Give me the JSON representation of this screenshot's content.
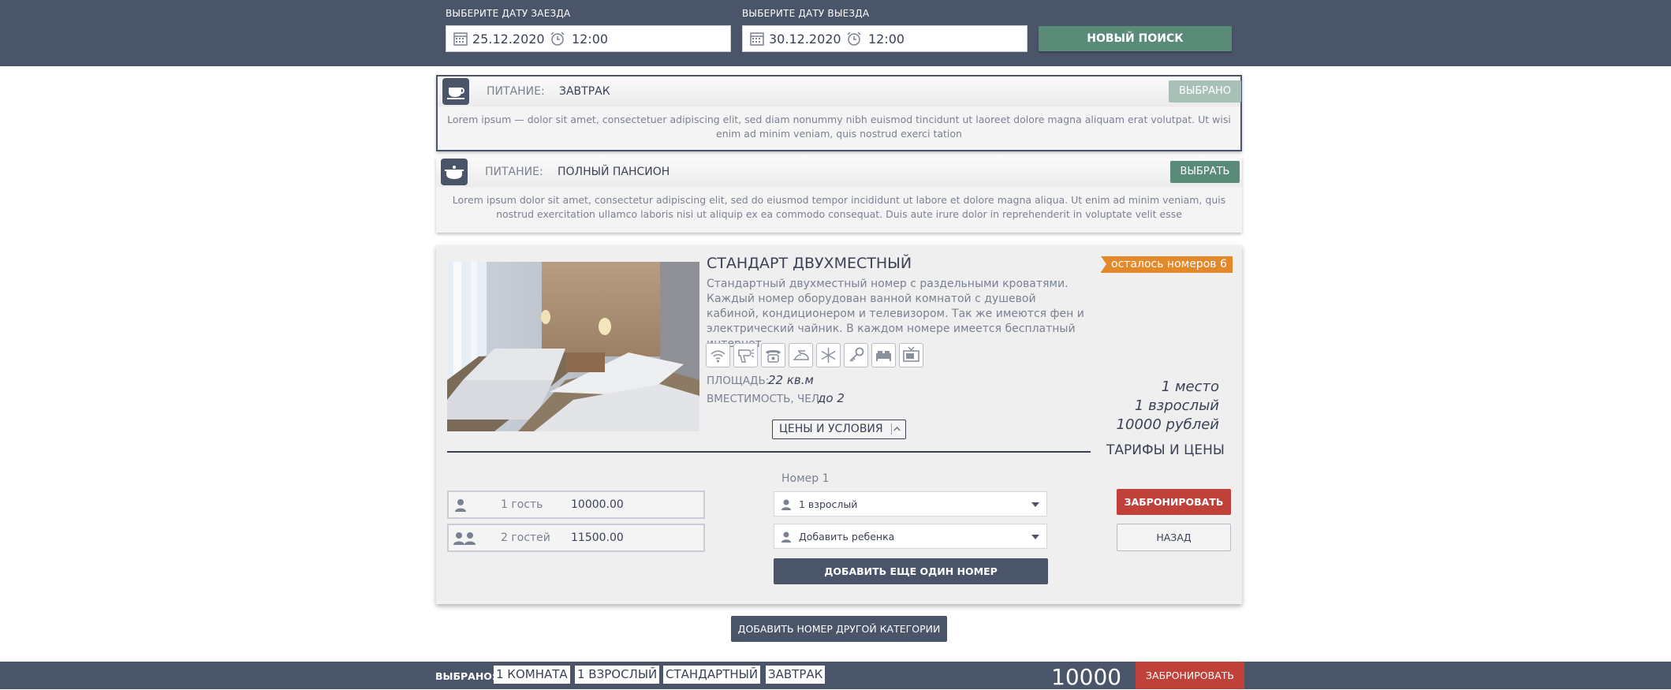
{
  "search": {
    "checkin_label": "ВЫБЕРИТЕ ДАТУ ЗАЕЗДА",
    "checkin_date": "25.12.2020",
    "checkin_time": "12:00",
    "checkout_label": "ВЫБЕРИТЕ ДАТУ ВЫЕЗДА",
    "checkout_date": "30.12.2020",
    "checkout_time": "12:00",
    "new_search_label": "НОВЫЙ ПОИСК"
  },
  "meals": [
    {
      "key": "ПИТАНИЕ:",
      "value": "ЗАВТРАК",
      "button": "ВЫБРАНО",
      "selected": true,
      "description": "Lorem ipsum — dolor sit amet, consectetuer adipiscing elit, sed diam nonummy nibh euismod tincidunt ut laoreet dolore magna aliquam erat volutpat. Ut wisi enim ad minim veniam, quis nostrud exerci tation",
      "icon": "cup-icon"
    },
    {
      "key": "ПИТАНИЕ:",
      "value": "ПОЛНЫЙ ПАНСИОН",
      "button": "ВЫБРАТЬ",
      "selected": false,
      "description": "Lorem ipsum dolor sit amet, consectetur adipiscing elit, sed do eiusmod tempor incididunt ut labore et dolore magna aliqua. Ut enim ad minim veniam, quis nostrud exercitation ullamco laboris nisi ut aliquip ex ea commodo consequat. Duis aute irure dolor in reprehenderit in voluptate velit esse",
      "icon": "pot-icon"
    }
  ],
  "room": {
    "title": "СТАНДАРТ ДВУХМЕСТНЫЙ",
    "description": "Стандартный двухместный номер с раздельными кроватями. Каждый номер оборудован ванной комнатой с душевой кабиной, кондиционером и телевизором. Так же имеются фен и электрический чайник. В каждом номере имеется бесплатный интернет.",
    "badge": "осталось номеров 6",
    "amenities": [
      "wifi-icon",
      "hairdryer-icon",
      "phone-icon",
      "iron-icon",
      "snowflake-icon",
      "key-icon",
      "bed-icon",
      "tv-icon"
    ],
    "area_label": "ПЛОЩАДЬ:",
    "area_value": "22 кв.м",
    "capacity_label": "ВМЕСТИМОСТЬ, ЧЕЛ:",
    "capacity_value": "до 2",
    "prices_button": "ЦЕНЫ И УСЛОВИЯ",
    "price_summary": [
      "1 место",
      "1 взрослый",
      "10000 рублей"
    ],
    "tariffs_title": "ТАРИФЫ И ЦЕНЫ",
    "guest_rates": [
      {
        "guests": "1 гость",
        "price": "10000.00"
      },
      {
        "guests": "2 гостей",
        "price": "11500.00"
      }
    ],
    "room_number_label": "Номер 1",
    "adults_select": "1 взрослый",
    "child_select": "Добавить ребенка",
    "add_one_more": "ДОБАВИТЬ ЕЩЕ ОДИН НОМЕР",
    "book_button": "ЗАБРОНИРОВАТЬ",
    "back_button": "НАЗАД"
  },
  "add_other_category": "ДОБАВИТЬ НОМЕР ДРУГОЙ КАТЕГОРИИ",
  "footer": {
    "selected_label": "ВЫБРАНО:",
    "tags": [
      "1 КОМНАТА",
      "1 ВЗРОСЛЫЙ",
      "СТАНДАРТНЫЙ",
      "ЗАВТРАК"
    ],
    "total": "10000",
    "book_button": "ЗАБРОНИРОВАТЬ"
  },
  "colors": {
    "header_bg": "#4b5569",
    "accent_green": "#5a8a78",
    "accent_red": "#c0403a",
    "badge_orange": "#e3892b"
  }
}
